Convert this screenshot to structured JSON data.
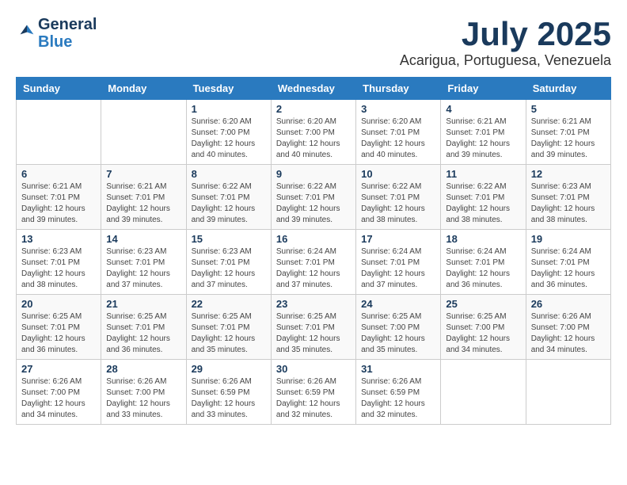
{
  "header": {
    "logo_general": "General",
    "logo_blue": "Blue",
    "month_title": "July 2025",
    "location": "Acarigua, Portuguesa, Venezuela"
  },
  "calendar": {
    "weekdays": [
      "Sunday",
      "Monday",
      "Tuesday",
      "Wednesday",
      "Thursday",
      "Friday",
      "Saturday"
    ],
    "weeks": [
      [
        {
          "day": "",
          "info": ""
        },
        {
          "day": "",
          "info": ""
        },
        {
          "day": "1",
          "info": "Sunrise: 6:20 AM\nSunset: 7:00 PM\nDaylight: 12 hours and 40 minutes."
        },
        {
          "day": "2",
          "info": "Sunrise: 6:20 AM\nSunset: 7:00 PM\nDaylight: 12 hours and 40 minutes."
        },
        {
          "day": "3",
          "info": "Sunrise: 6:20 AM\nSunset: 7:01 PM\nDaylight: 12 hours and 40 minutes."
        },
        {
          "day": "4",
          "info": "Sunrise: 6:21 AM\nSunset: 7:01 PM\nDaylight: 12 hours and 39 minutes."
        },
        {
          "day": "5",
          "info": "Sunrise: 6:21 AM\nSunset: 7:01 PM\nDaylight: 12 hours and 39 minutes."
        }
      ],
      [
        {
          "day": "6",
          "info": "Sunrise: 6:21 AM\nSunset: 7:01 PM\nDaylight: 12 hours and 39 minutes."
        },
        {
          "day": "7",
          "info": "Sunrise: 6:21 AM\nSunset: 7:01 PM\nDaylight: 12 hours and 39 minutes."
        },
        {
          "day": "8",
          "info": "Sunrise: 6:22 AM\nSunset: 7:01 PM\nDaylight: 12 hours and 39 minutes."
        },
        {
          "day": "9",
          "info": "Sunrise: 6:22 AM\nSunset: 7:01 PM\nDaylight: 12 hours and 39 minutes."
        },
        {
          "day": "10",
          "info": "Sunrise: 6:22 AM\nSunset: 7:01 PM\nDaylight: 12 hours and 38 minutes."
        },
        {
          "day": "11",
          "info": "Sunrise: 6:22 AM\nSunset: 7:01 PM\nDaylight: 12 hours and 38 minutes."
        },
        {
          "day": "12",
          "info": "Sunrise: 6:23 AM\nSunset: 7:01 PM\nDaylight: 12 hours and 38 minutes."
        }
      ],
      [
        {
          "day": "13",
          "info": "Sunrise: 6:23 AM\nSunset: 7:01 PM\nDaylight: 12 hours and 38 minutes."
        },
        {
          "day": "14",
          "info": "Sunrise: 6:23 AM\nSunset: 7:01 PM\nDaylight: 12 hours and 37 minutes."
        },
        {
          "day": "15",
          "info": "Sunrise: 6:23 AM\nSunset: 7:01 PM\nDaylight: 12 hours and 37 minutes."
        },
        {
          "day": "16",
          "info": "Sunrise: 6:24 AM\nSunset: 7:01 PM\nDaylight: 12 hours and 37 minutes."
        },
        {
          "day": "17",
          "info": "Sunrise: 6:24 AM\nSunset: 7:01 PM\nDaylight: 12 hours and 37 minutes."
        },
        {
          "day": "18",
          "info": "Sunrise: 6:24 AM\nSunset: 7:01 PM\nDaylight: 12 hours and 36 minutes."
        },
        {
          "day": "19",
          "info": "Sunrise: 6:24 AM\nSunset: 7:01 PM\nDaylight: 12 hours and 36 minutes."
        }
      ],
      [
        {
          "day": "20",
          "info": "Sunrise: 6:25 AM\nSunset: 7:01 PM\nDaylight: 12 hours and 36 minutes."
        },
        {
          "day": "21",
          "info": "Sunrise: 6:25 AM\nSunset: 7:01 PM\nDaylight: 12 hours and 36 minutes."
        },
        {
          "day": "22",
          "info": "Sunrise: 6:25 AM\nSunset: 7:01 PM\nDaylight: 12 hours and 35 minutes."
        },
        {
          "day": "23",
          "info": "Sunrise: 6:25 AM\nSunset: 7:01 PM\nDaylight: 12 hours and 35 minutes."
        },
        {
          "day": "24",
          "info": "Sunrise: 6:25 AM\nSunset: 7:00 PM\nDaylight: 12 hours and 35 minutes."
        },
        {
          "day": "25",
          "info": "Sunrise: 6:25 AM\nSunset: 7:00 PM\nDaylight: 12 hours and 34 minutes."
        },
        {
          "day": "26",
          "info": "Sunrise: 6:26 AM\nSunset: 7:00 PM\nDaylight: 12 hours and 34 minutes."
        }
      ],
      [
        {
          "day": "27",
          "info": "Sunrise: 6:26 AM\nSunset: 7:00 PM\nDaylight: 12 hours and 34 minutes."
        },
        {
          "day": "28",
          "info": "Sunrise: 6:26 AM\nSunset: 7:00 PM\nDaylight: 12 hours and 33 minutes."
        },
        {
          "day": "29",
          "info": "Sunrise: 6:26 AM\nSunset: 6:59 PM\nDaylight: 12 hours and 33 minutes."
        },
        {
          "day": "30",
          "info": "Sunrise: 6:26 AM\nSunset: 6:59 PM\nDaylight: 12 hours and 32 minutes."
        },
        {
          "day": "31",
          "info": "Sunrise: 6:26 AM\nSunset: 6:59 PM\nDaylight: 12 hours and 32 minutes."
        },
        {
          "day": "",
          "info": ""
        },
        {
          "day": "",
          "info": ""
        }
      ]
    ]
  }
}
